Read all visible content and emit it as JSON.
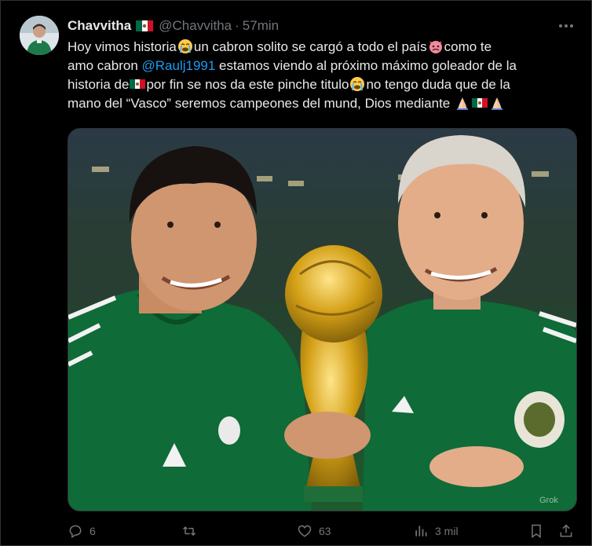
{
  "tweet": {
    "author_name": "Chavvitha",
    "handle": "@Chavvitha",
    "separator": "·",
    "time": "57min",
    "text_segments": {
      "s1": "Hoy vimos historia",
      "s2": "un cabron solito se cargó a todo el país",
      "s3": "como te",
      "s4": "amo cabron ",
      "mention": "@Raulj1991",
      "s5": " estamos viendo al próximo máximo goleador de la",
      "s6": "historia de",
      "s7": "por fin se nos da este pinche titulo",
      "s8": "no tengo duda que de la",
      "s9": "mano del “Vasco” seremos campeones del mund, Dios mediante "
    },
    "emojis": [
      "loudly-crying-face",
      "angry-devil-face",
      "mexico-flag",
      "loudly-crying-face",
      "folded-hands",
      "mexico-flag",
      "folded-hands"
    ],
    "image": {
      "watermark": "Grok"
    }
  },
  "actions": {
    "replies": "6",
    "reposts": "",
    "likes": "63",
    "views": "3 mil"
  },
  "colors": {
    "background": "#000000",
    "text": "#e7e9ea",
    "secondary": "#71767b",
    "link": "#1d9bf0",
    "border": "#2f3336"
  }
}
